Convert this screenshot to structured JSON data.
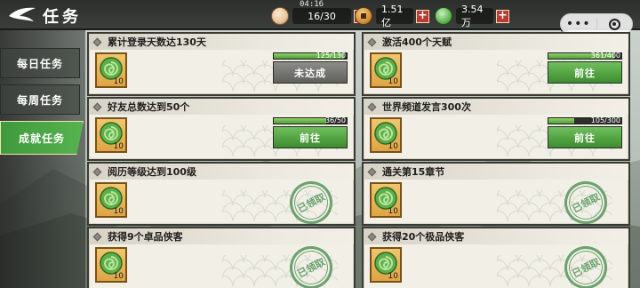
{
  "header": {
    "title": "任务",
    "timer": "04:16",
    "resources": [
      {
        "icon": "bun-icon",
        "value": "16/30"
      },
      {
        "icon": "coin-icon",
        "value": "1.51亿"
      },
      {
        "icon": "jade-icon",
        "value": "3.54万"
      }
    ],
    "plus_label": "+",
    "more_label": "•••"
  },
  "tabs": [
    {
      "label": "每日任务",
      "active": false
    },
    {
      "label": "每周任务",
      "active": false
    },
    {
      "label": "成就任务",
      "active": true
    }
  ],
  "tasks": [
    {
      "title": "累计登录天数达130天",
      "reward_count": "10",
      "progress": "125/130",
      "progress_fraction": 0.96,
      "button": "未达成",
      "state": "pending"
    },
    {
      "title": "激活400个天赋",
      "reward_count": "10",
      "progress": "361/400",
      "progress_fraction": 0.9,
      "button": "前往",
      "state": "go"
    },
    {
      "title": "好友总数达到50个",
      "reward_count": "10",
      "progress": "36/50",
      "progress_fraction": 0.72,
      "button": "前往",
      "state": "go"
    },
    {
      "title": "世界频道发言300次",
      "reward_count": "10",
      "progress": "105/300",
      "progress_fraction": 0.35,
      "button": "前往",
      "state": "go"
    },
    {
      "title": "阅历等级达到100级",
      "reward_count": "10",
      "stamp": "已领取",
      "state": "claimed"
    },
    {
      "title": "通关第15章节",
      "reward_count": "10",
      "stamp": "已领取",
      "state": "claimed"
    },
    {
      "title": "获得9个卓品侠客",
      "reward_count": "10",
      "stamp": "已领取",
      "state": "claimed"
    },
    {
      "title": "获得20个极品侠客",
      "reward_count": "10",
      "stamp": "已领取",
      "state": "claimed"
    }
  ],
  "colors": {
    "accent_green": "#4f9d36",
    "plus_red": "#b93c2e",
    "card_bg": "#f2efe6"
  }
}
